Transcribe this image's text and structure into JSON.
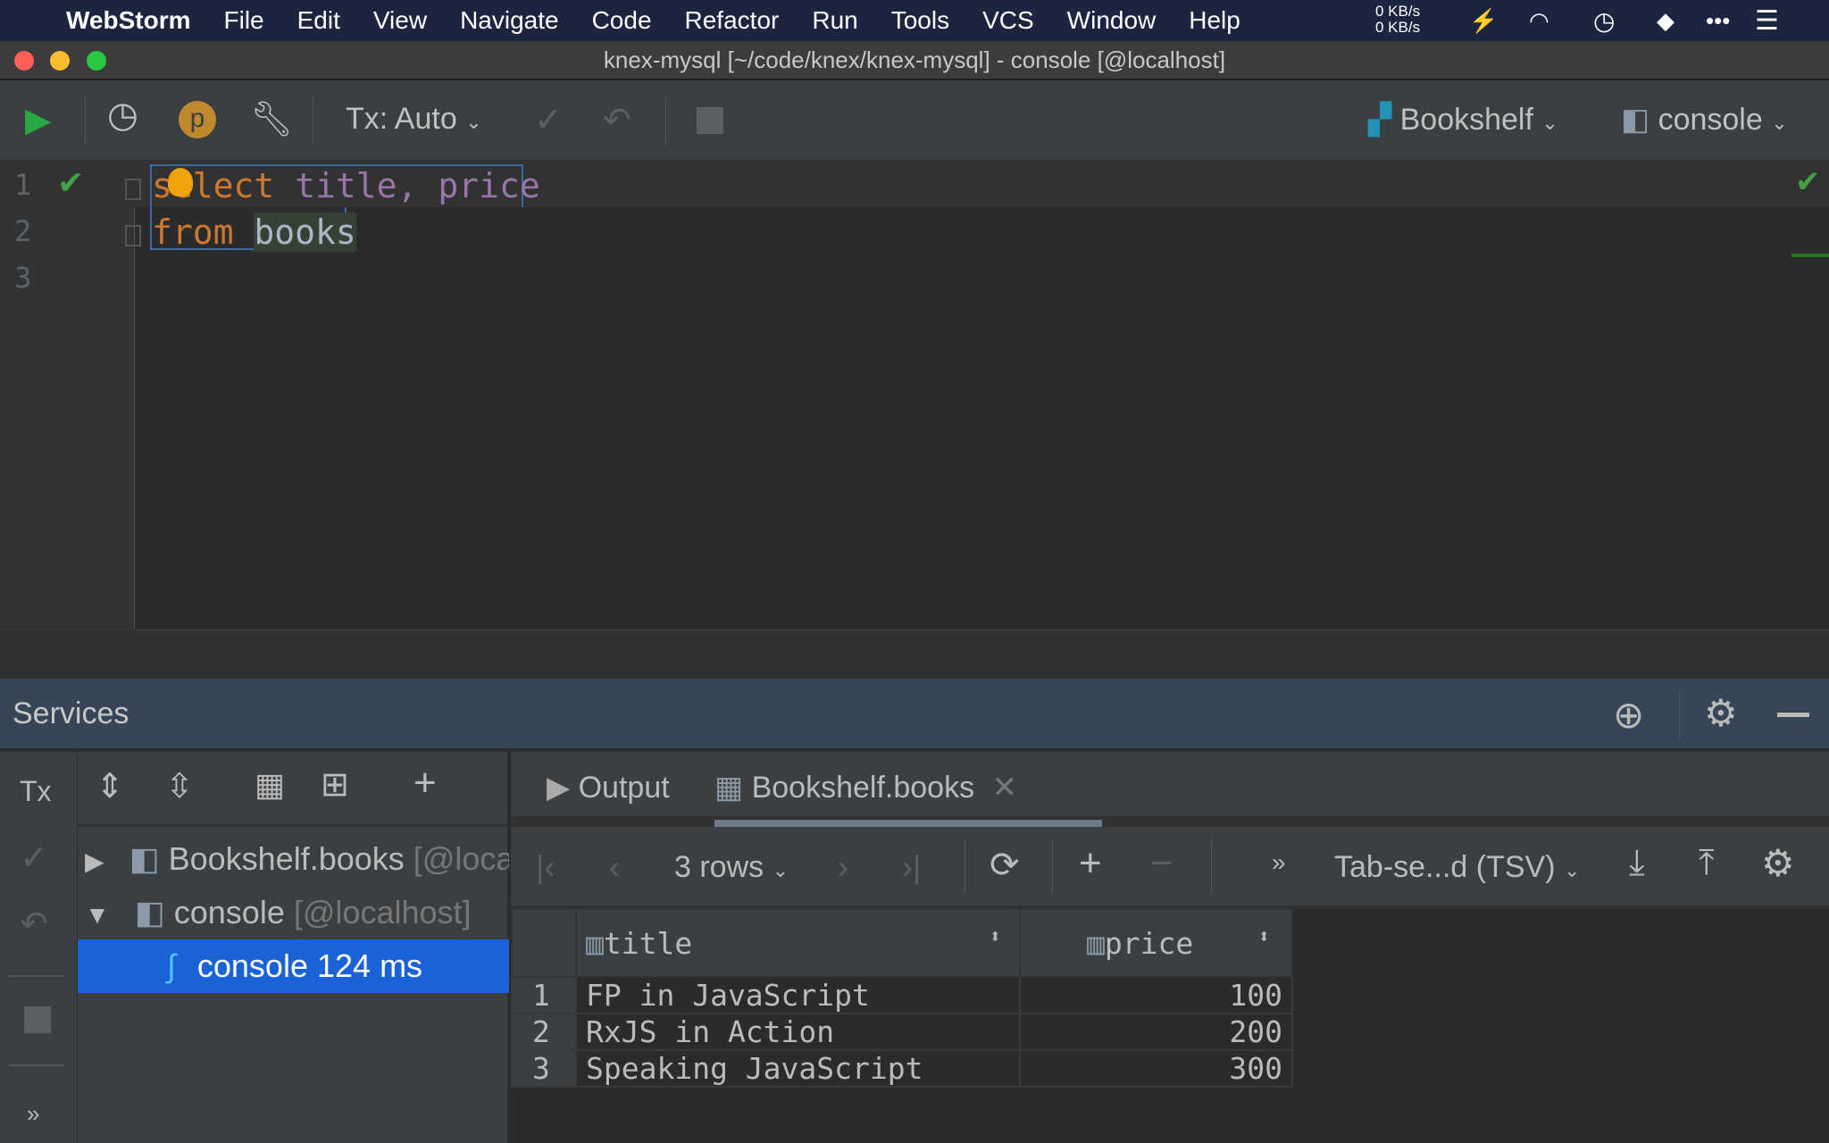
{
  "menubar": {
    "app": "WebStorm",
    "items": [
      "File",
      "Edit",
      "View",
      "Navigate",
      "Code",
      "Refactor",
      "Run",
      "Tools",
      "VCS",
      "Window",
      "Help"
    ],
    "net_up": "0 KB/s",
    "net_down": "0 KB/s"
  },
  "window": {
    "title": "knex-mysql [~/code/knex/knex-mysql] - console [@localhost]"
  },
  "toolbar": {
    "tx_mode": "Tx: Auto",
    "datasource": "Bookshelf",
    "session": "console",
    "profile_letter": "p"
  },
  "editor": {
    "line_numbers": [
      "1",
      "2",
      "3"
    ],
    "line1": {
      "kw": "select",
      "rest": "title, price"
    },
    "line2": {
      "kw": "from",
      "table": "books"
    }
  },
  "services": {
    "title": "Services",
    "tx_label": "Tx",
    "tree": [
      {
        "label": "Bookshelf.books",
        "suffix": "[@localhost]"
      },
      {
        "label": "console",
        "suffix": "[@localhost]"
      },
      {
        "label": "console",
        "duration": "124 ms"
      }
    ],
    "tabs": [
      {
        "label": "Output"
      },
      {
        "label": "Bookshelf.books",
        "active": true
      }
    ],
    "rows_label": "3 rows",
    "format": "Tab-se...d (TSV)",
    "table": {
      "columns": [
        "title",
        "price"
      ],
      "rows": [
        [
          "1",
          "FP in JavaScript",
          "100"
        ],
        [
          "2",
          "RxJS in Action",
          "200"
        ],
        [
          "3",
          "Speaking JavaScript",
          "300"
        ]
      ]
    }
  },
  "colors": {
    "menubar": "#1c2540",
    "selection": "#1a62d6",
    "keyword": "#cc7832",
    "identifier": "#9876aa",
    "run_green": "#29a745",
    "services_header": "#374656"
  }
}
